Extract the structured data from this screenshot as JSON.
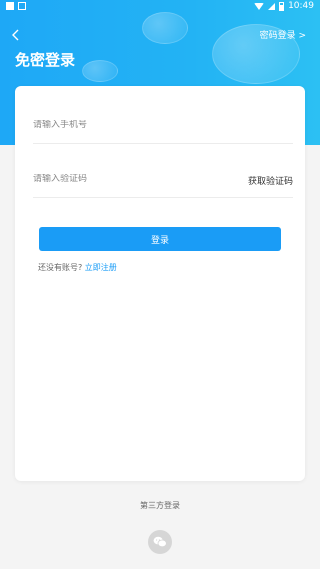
{
  "status_bar": {
    "time": "10:49"
  },
  "header": {
    "back_icon": "chevron-left-icon",
    "password_login": "密码登录 >",
    "title": "免密登录"
  },
  "form": {
    "phone_placeholder": "请输入手机号",
    "code_placeholder": "请输入验证码",
    "get_code": "获取验证码",
    "login_button": "登录",
    "no_account": "还没有账号?",
    "register_now": "立即注册"
  },
  "third_party": {
    "label": "第三方登录",
    "wechat_icon": "wechat-icon"
  },
  "colors": {
    "accent": "#1a9cf6",
    "header_start": "#1ea8f6",
    "header_end": "#2cc0f3"
  }
}
